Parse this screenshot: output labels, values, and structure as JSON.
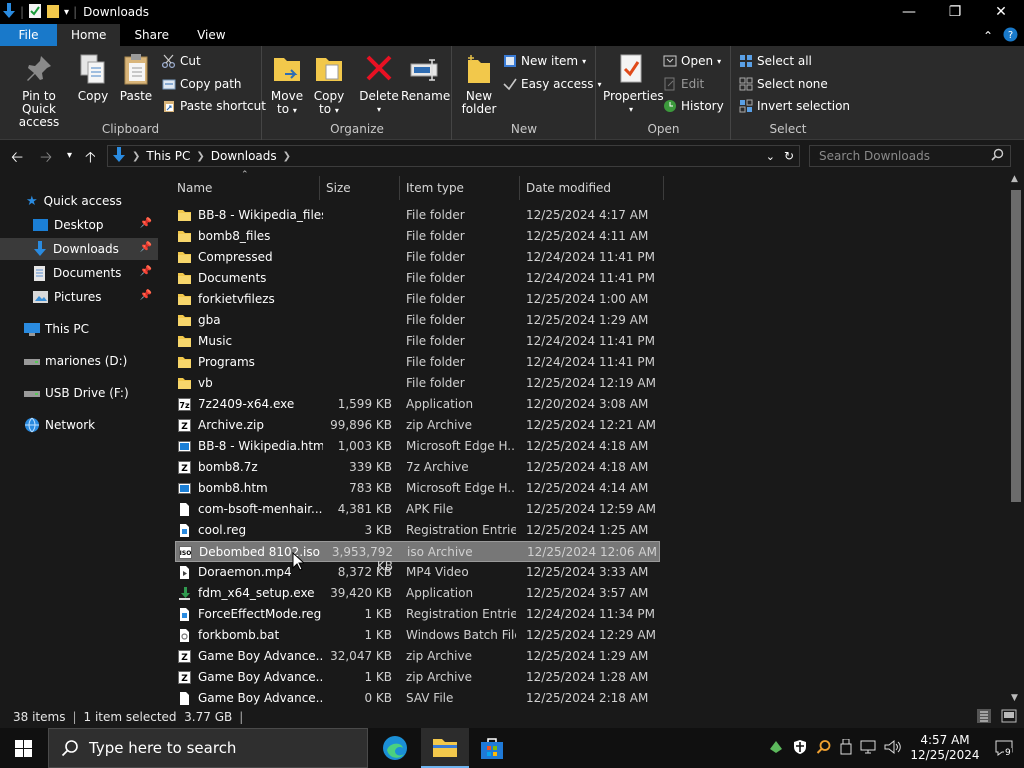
{
  "window": {
    "title": "Downloads"
  },
  "tabs": {
    "file": "File",
    "home": "Home",
    "share": "Share",
    "view": "View"
  },
  "ribbon": {
    "clipboard": {
      "label": "Clipboard",
      "pin": "Pin to Quick access",
      "pin_l1": "Pin to Quick",
      "pin_l2": "access",
      "copy": "Copy",
      "paste": "Paste",
      "cut": "Cut",
      "copy_path": "Copy path",
      "paste_shortcut": "Paste shortcut"
    },
    "organize": {
      "label": "Organize",
      "move_l1": "Move",
      "move_l2": "to",
      "copy_l1": "Copy",
      "copy_l2": "to",
      "delete": "Delete",
      "rename": "Rename"
    },
    "new": {
      "label": "New",
      "folder_l1": "New",
      "folder_l2": "folder",
      "new_item": "New item",
      "easy_access": "Easy access"
    },
    "open": {
      "label": "Open",
      "properties": "Properties",
      "open": "Open",
      "edit": "Edit",
      "history": "History"
    },
    "select": {
      "label": "Select",
      "select_all": "Select all",
      "select_none": "Select none",
      "invert": "Invert selection"
    }
  },
  "address": {
    "crumb1": "This PC",
    "crumb2": "Downloads",
    "search_placeholder": "Search Downloads"
  },
  "navpane": {
    "quick_access": "Quick access",
    "desktop": "Desktop",
    "downloads": "Downloads",
    "documents": "Documents",
    "pictures": "Pictures",
    "this_pc": "This PC",
    "drive_d": "mariones (D:)",
    "drive_f": "USB Drive (F:)",
    "network": "Network"
  },
  "columns": {
    "name": "Name",
    "size": "Size",
    "type": "Item type",
    "date": "Date modified"
  },
  "files": [
    {
      "name": "BB-8 - Wikipedia_files",
      "size": "",
      "type": "File folder",
      "date": "12/25/2024 4:17 AM",
      "icon": "folder"
    },
    {
      "name": "bomb8_files",
      "size": "",
      "type": "File folder",
      "date": "12/25/2024 4:11 AM",
      "icon": "folder"
    },
    {
      "name": "Compressed",
      "size": "",
      "type": "File folder",
      "date": "12/24/2024 11:41 PM",
      "icon": "folder"
    },
    {
      "name": "Documents",
      "size": "",
      "type": "File folder",
      "date": "12/24/2024 11:41 PM",
      "icon": "folder"
    },
    {
      "name": "forkietvfilezs",
      "size": "",
      "type": "File folder",
      "date": "12/25/2024 1:00 AM",
      "icon": "folder"
    },
    {
      "name": "gba",
      "size": "",
      "type": "File folder",
      "date": "12/25/2024 1:29 AM",
      "icon": "folder"
    },
    {
      "name": "Music",
      "size": "",
      "type": "File folder",
      "date": "12/24/2024 11:41 PM",
      "icon": "folder"
    },
    {
      "name": "Programs",
      "size": "",
      "type": "File folder",
      "date": "12/24/2024 11:41 PM",
      "icon": "folder"
    },
    {
      "name": "vb",
      "size": "",
      "type": "File folder",
      "date": "12/25/2024 12:19 AM",
      "icon": "folder"
    },
    {
      "name": "7z2409-x64.exe",
      "size": "1,599 KB",
      "type": "Application",
      "date": "12/20/2024 3:08 AM",
      "icon": "exe"
    },
    {
      "name": "Archive.zip",
      "size": "99,896 KB",
      "type": "zip Archive",
      "date": "12/25/2024 12:21 AM",
      "icon": "archive"
    },
    {
      "name": "BB-8 - Wikipedia.htm",
      "size": "1,003 KB",
      "type": "Microsoft Edge H...",
      "date": "12/25/2024 4:18 AM",
      "icon": "htm"
    },
    {
      "name": "bomb8.7z",
      "size": "339 KB",
      "type": "7z Archive",
      "date": "12/25/2024 4:18 AM",
      "icon": "archive"
    },
    {
      "name": "bomb8.htm",
      "size": "783 KB",
      "type": "Microsoft Edge H...",
      "date": "12/25/2024 4:14 AM",
      "icon": "htm"
    },
    {
      "name": "com-bsoft-menhair...",
      "size": "4,381 KB",
      "type": "APK File",
      "date": "12/25/2024 12:59 AM",
      "icon": "file"
    },
    {
      "name": "cool.reg",
      "size": "3 KB",
      "type": "Registration Entries",
      "date": "12/25/2024 1:25 AM",
      "icon": "reg"
    },
    {
      "name": "Debombed 8102.iso",
      "size": "3,953,792 KB",
      "type": "iso Archive",
      "date": "12/25/2024 12:06 AM",
      "icon": "iso",
      "selected": true
    },
    {
      "name": "Doraemon.mp4",
      "size": "8,372 KB",
      "type": "MP4 Video",
      "date": "12/25/2024 3:33 AM",
      "icon": "video"
    },
    {
      "name": "fdm_x64_setup.exe",
      "size": "39,420 KB",
      "type": "Application",
      "date": "12/25/2024 3:57 AM",
      "icon": "setup"
    },
    {
      "name": "ForceEffectMode.reg",
      "size": "1 KB",
      "type": "Registration Entries",
      "date": "12/24/2024 11:34 PM",
      "icon": "reg"
    },
    {
      "name": "forkbomb.bat",
      "size": "1 KB",
      "type": "Windows Batch File",
      "date": "12/25/2024 12:29 AM",
      "icon": "bat"
    },
    {
      "name": "Game Boy Advance...",
      "size": "32,047 KB",
      "type": "zip Archive",
      "date": "12/25/2024 1:29 AM",
      "icon": "archive"
    },
    {
      "name": "Game Boy Advance...",
      "size": "1 KB",
      "type": "zip Archive",
      "date": "12/25/2024 1:28 AM",
      "icon": "archive"
    },
    {
      "name": "Game Boy Advance...",
      "size": "0 KB",
      "type": "SAV File",
      "date": "12/25/2024 2:18 AM",
      "icon": "file"
    }
  ],
  "status": {
    "count": "38 items",
    "selection": "1 item selected  3.77 GB"
  },
  "taskbar": {
    "search_placeholder": "Type here to search",
    "time": "4:57 AM",
    "date": "12/25/2024",
    "notifications": "9"
  },
  "colors": {
    "accent": "#1979ca",
    "folder": "#f2c84b",
    "background": "#191919",
    "ribbon": "#2b2b2b",
    "selection": "#777777"
  }
}
